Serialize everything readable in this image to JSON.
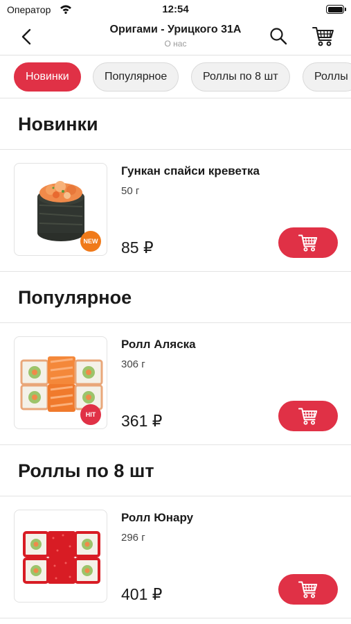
{
  "status_bar": {
    "carrier": "Оператор",
    "time": "12:54",
    "icons": [
      "wifi-icon",
      "battery-icon"
    ]
  },
  "nav": {
    "title": "Оригами - Урицкого 31А",
    "subtitle": "О нас",
    "icons": [
      "back-chevron-icon",
      "search-icon",
      "cart-icon"
    ]
  },
  "tabs": [
    {
      "label": "Новинки",
      "active": true
    },
    {
      "label": "Популярное",
      "active": false
    },
    {
      "label": "Роллы по 8 шт",
      "active": false
    },
    {
      "label": "Роллы",
      "active": false
    }
  ],
  "sections": [
    {
      "title": "Новинки",
      "products": [
        {
          "name": "Гункан спайси креветка",
          "weight": "50 г",
          "price": "85 ₽",
          "badge": "NEW"
        }
      ]
    },
    {
      "title": "Популярное",
      "products": [
        {
          "name": "Ролл Аляска",
          "weight": "306 г",
          "price": "361 ₽",
          "badge": "HIT"
        }
      ]
    },
    {
      "title": "Роллы по 8 шт",
      "products": [
        {
          "name": "Ролл Юнару",
          "weight": "296 г",
          "price": "401 ₽",
          "badge": ""
        }
      ]
    }
  ],
  "colors": {
    "accent": "#e03146",
    "new_badge": "#f07a1a",
    "divider": "#e3e3e3",
    "tab_bg": "#f1f1f1"
  }
}
